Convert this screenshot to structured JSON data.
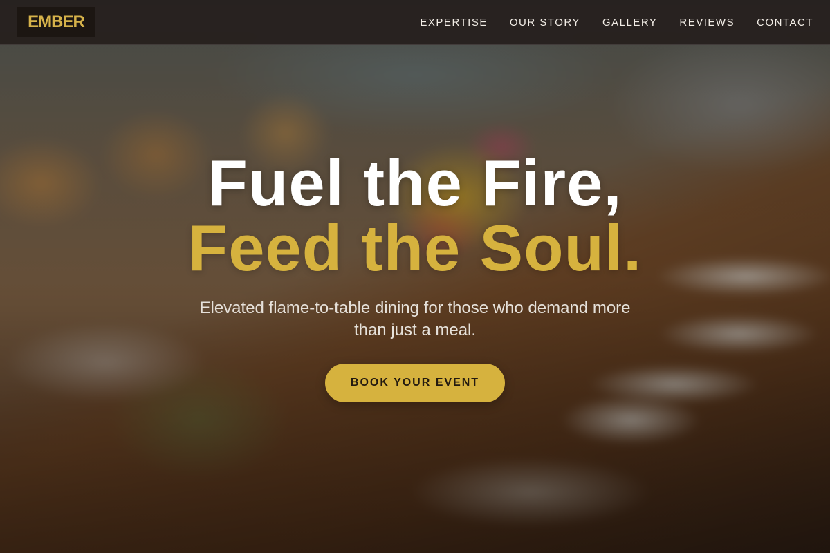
{
  "brand": {
    "logo_text": "EMBER"
  },
  "nav": {
    "items": [
      {
        "label": "EXPERTISE"
      },
      {
        "label": "OUR STORY"
      },
      {
        "label": "GALLERY"
      },
      {
        "label": "REVIEWS"
      },
      {
        "label": "CONTACT"
      }
    ]
  },
  "hero": {
    "headline_line1": "Fuel the Fire,",
    "headline_line2": "Feed the Soul.",
    "subtitle": "Elevated flame-to-table dining for those who demand more than just a meal.",
    "cta_label": "BOOK YOUR EVENT",
    "background_image": "blurred-banquet-table-icon"
  },
  "colors": {
    "accent_gold": "#d6b23e",
    "navbar_bg": "#26201e",
    "logo_bg": "#1c1612",
    "text_light": "#f2ede6"
  }
}
